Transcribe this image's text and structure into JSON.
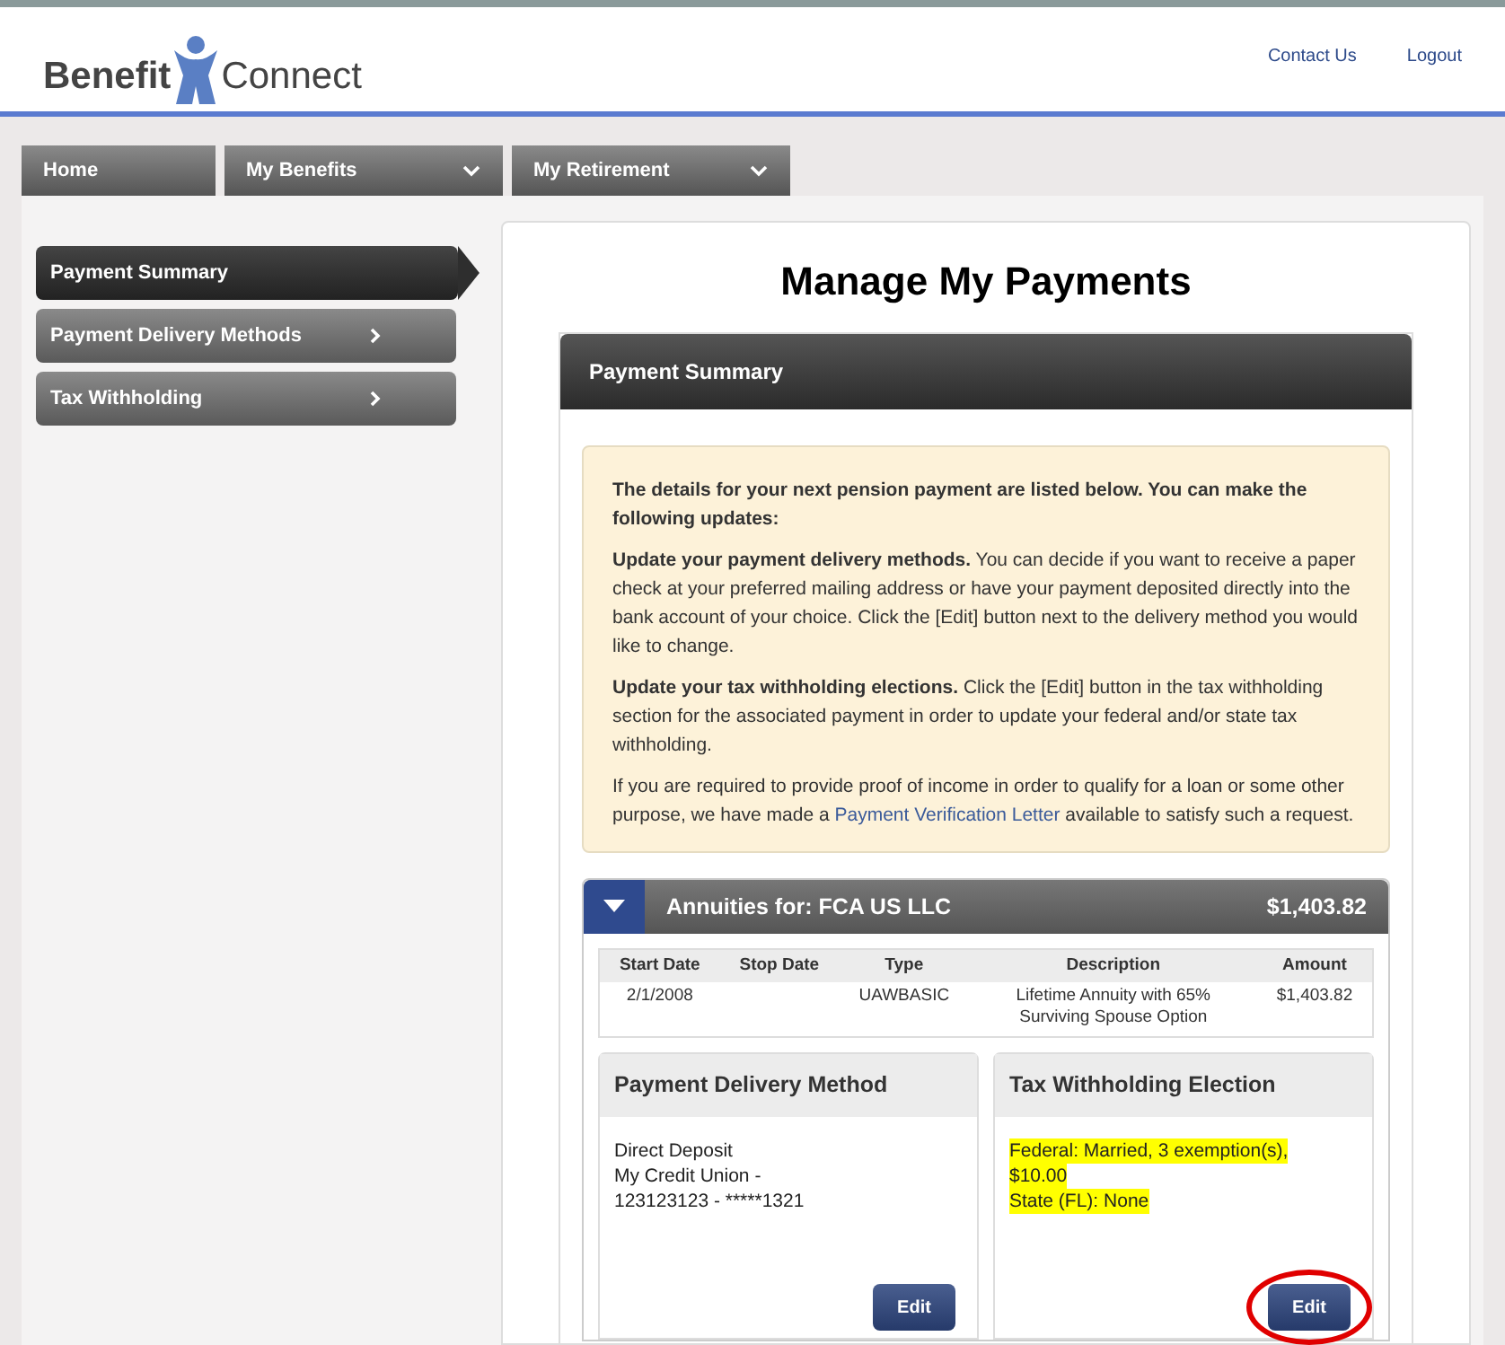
{
  "header": {
    "logo_left": "Benefit",
    "logo_right": "Connect",
    "links": [
      "Contact Us",
      "Logout"
    ]
  },
  "tabs": [
    {
      "label": "Home",
      "dropdown": false
    },
    {
      "label": "My Benefits",
      "dropdown": true
    },
    {
      "label": "My Retirement",
      "dropdown": true
    }
  ],
  "sidebar": {
    "items": [
      {
        "label": "Payment Summary",
        "selected": true
      },
      {
        "label": "Payment Delivery Methods",
        "selected": false
      },
      {
        "label": "Tax Withholding",
        "selected": false
      }
    ]
  },
  "page_title": "Manage My Payments",
  "panel": {
    "title": "Payment Summary",
    "info": {
      "paragraphs": [
        "**The details for your next pension payment are listed below. You can make the following updates:**",
        "**Update your payment delivery methods.** You can decide if you want to receive a paper check at your preferred mailing address or have your payment deposited directly into the bank account of your choice. Click the [Edit] button next to the delivery method you would like to change.",
        "**Update your tax withholding elections.** Click the [Edit] button in the tax withholding section for the associated payment in order to update your federal and/or state tax withholding."
      ],
      "last_before": "If you are required to provide proof of income in order to qualify for a loan or some other purpose, we have made a ",
      "link": "Payment Verification Letter",
      "last_after": " available to satisfy such a request."
    },
    "annuity": {
      "title": "Annuities for: FCA US LLC",
      "amount": "$1,403.82",
      "expanded": true,
      "table": {
        "columns": [
          "Start Date",
          "Stop Date",
          "Type",
          "Description",
          "Amount"
        ],
        "rows": [
          [
            "2/1/2008",
            "",
            "UAWBASIC",
            "Lifetime Annuity with 65% Surviving Spouse Option",
            "$1,403.82"
          ]
        ]
      },
      "cards": [
        {
          "title": "Payment Delivery Method",
          "lines": [
            {
              "text": "Direct Deposit",
              "highlighted": false
            },
            {
              "text": "My Credit Union -",
              "highlighted": false
            },
            {
              "text": "123123123 - *****1321",
              "highlighted": false
            }
          ],
          "button": "Edit",
          "circled": false
        },
        {
          "title": "Tax Withholding Election",
          "lines": [
            {
              "text": "Federal: Married, 3 exemption(s),",
              "highlighted": true
            },
            {
              "text": "$10.00",
              "highlighted": true
            },
            {
              "text": "State (FL): None",
              "highlighted": true
            }
          ],
          "button": "Edit",
          "circled": true
        }
      ]
    }
  }
}
